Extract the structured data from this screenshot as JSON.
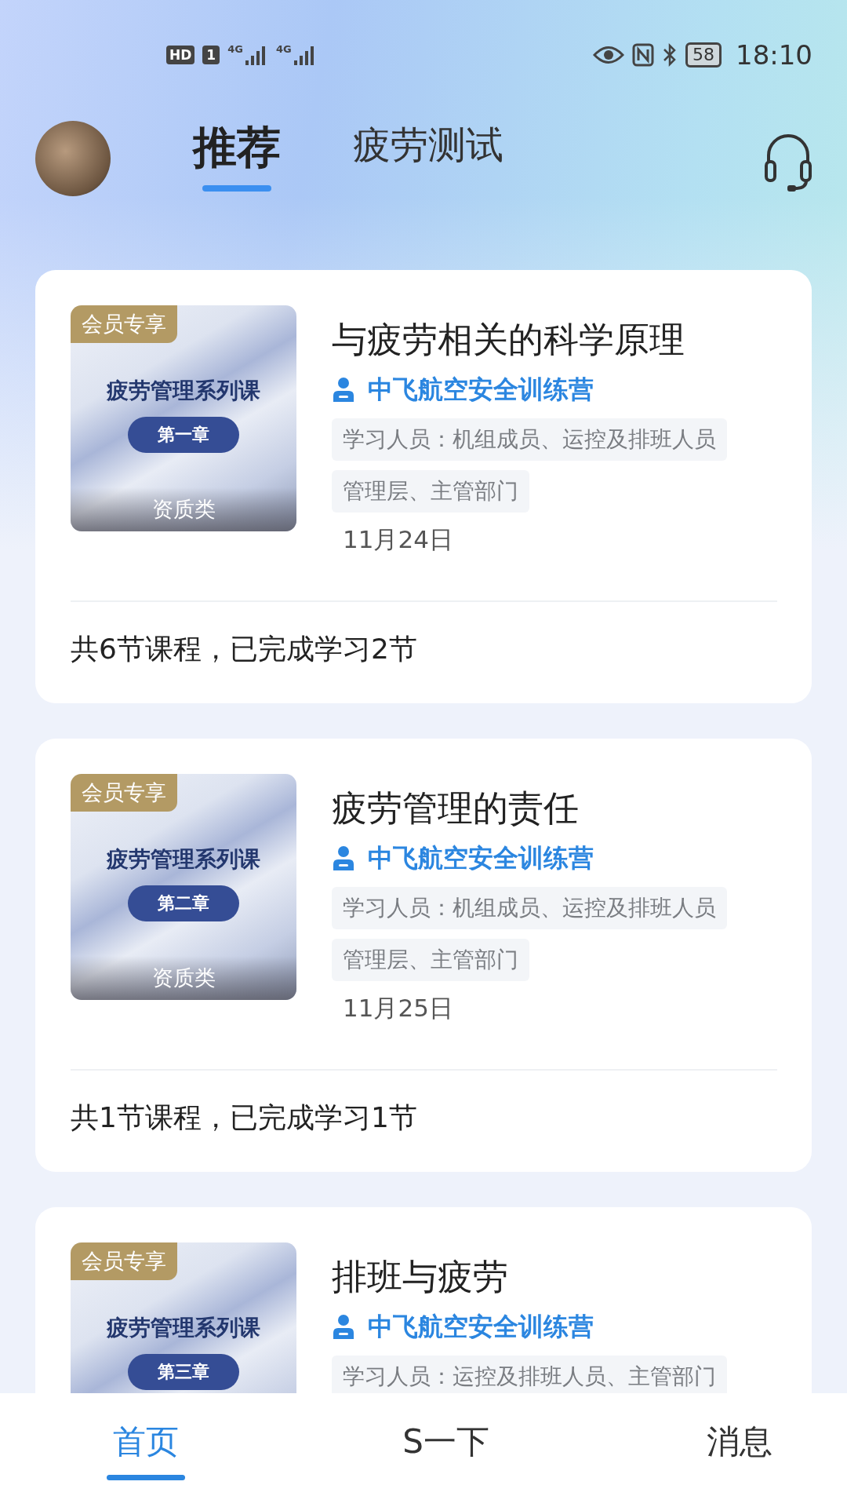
{
  "status_bar": {
    "left_badges": [
      "HD",
      "1"
    ],
    "network": [
      "4G",
      "4G"
    ],
    "battery": "58",
    "time": "18:10"
  },
  "header": {
    "tabs": [
      {
        "label": "推荐",
        "selected": true
      },
      {
        "label": "疲劳测试",
        "selected": false
      }
    ]
  },
  "courses": [
    {
      "badge": "会员专享",
      "series": "疲劳管理系列课",
      "chapter": "第一章",
      "category": "资质类",
      "title": "与疲劳相关的科学原理",
      "publisher": "中飞航空安全训练营",
      "audience": [
        "学习人员：机组成员、运控及排班人员",
        "管理层、主管部门"
      ],
      "date": "11月24日",
      "progress": "共6节课程，已完成学习2节"
    },
    {
      "badge": "会员专享",
      "series": "疲劳管理系列课",
      "chapter": "第二章",
      "category": "资质类",
      "title": "疲劳管理的责任",
      "publisher": "中飞航空安全训练营",
      "audience": [
        "学习人员：机组成员、运控及排班人员",
        "管理层、主管部门"
      ],
      "date": "11月25日",
      "progress": "共1节课程，已完成学习1节"
    },
    {
      "badge": "会员专享",
      "series": "疲劳管理系列课",
      "chapter": "第三章",
      "title": "排班与疲劳",
      "publisher": "中飞航空安全训练营",
      "audience": [
        "学习人员：运控及排班人员、主管部门"
      ]
    }
  ],
  "bottom_nav": [
    {
      "label": "首页",
      "selected": true
    },
    {
      "label": "S一下",
      "selected": false
    },
    {
      "label": "消息",
      "selected": false
    }
  ]
}
